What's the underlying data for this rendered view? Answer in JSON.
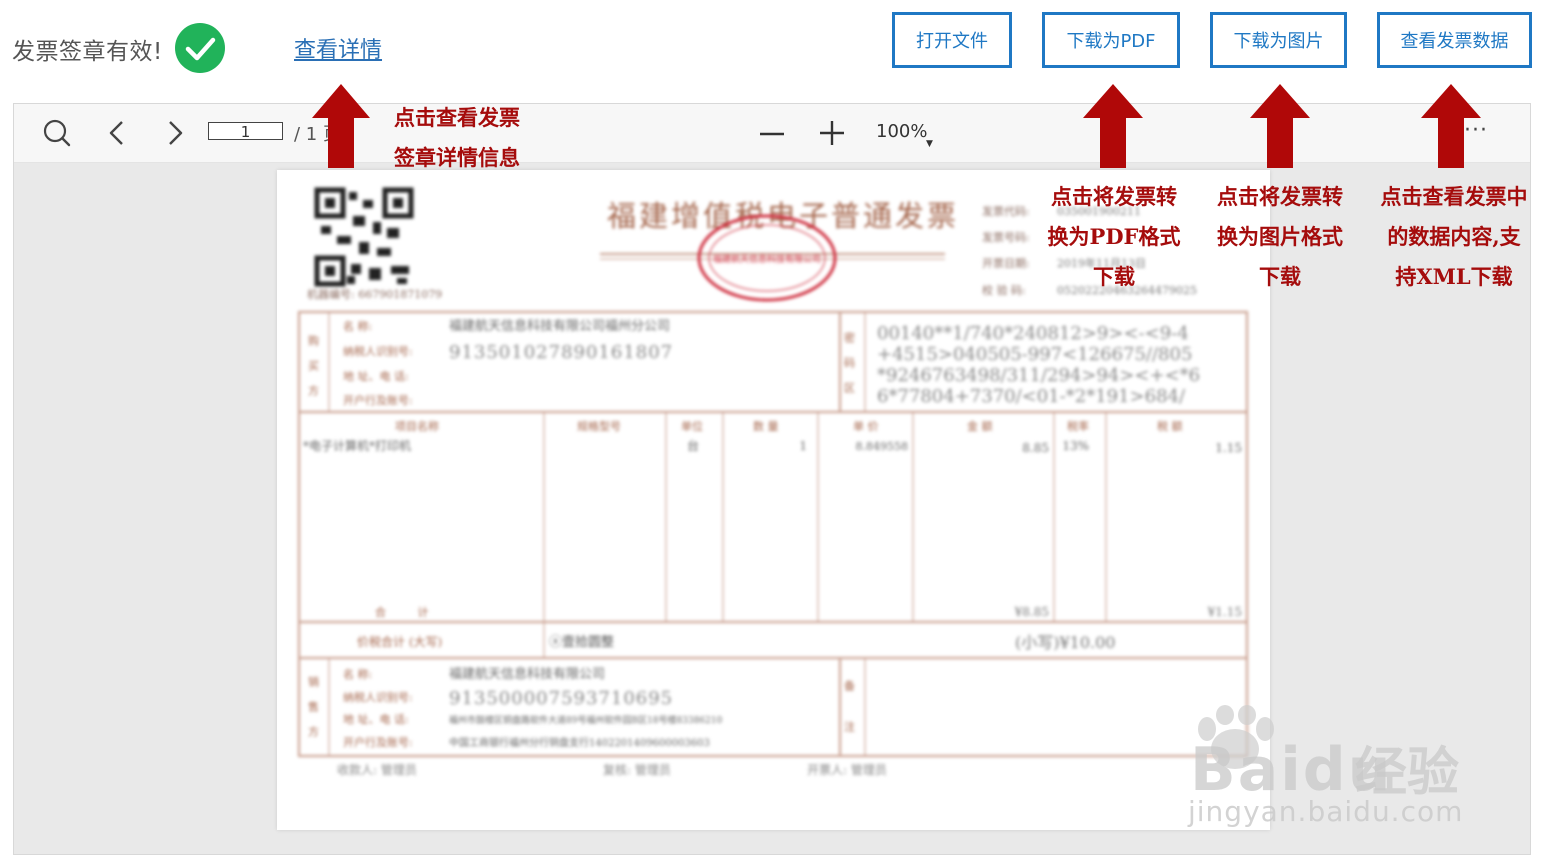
{
  "status": {
    "text": "发票签章有效!",
    "details_link": "查看详情"
  },
  "buttons": {
    "open": "打开文件",
    "pdf": "下载为PDF",
    "image": "下载为图片",
    "data": "查看发票数据"
  },
  "viewer": {
    "page_current": "1",
    "page_total": "/ 1 页",
    "zoom": "100%"
  },
  "invoice": {
    "title": "福建增值税电子普通发票",
    "machine_no": "机器编号: 667901871079",
    "invoice_code_label": "发票代码:",
    "invoice_code": "035001900211",
    "invoice_no_label": "发票号码:",
    "invoice_no": "",
    "issue_date_label": "开票日期:",
    "issue_date": "2019年11月13日",
    "check_code_label": "校 验 码:",
    "check_code": "05202220463264479025",
    "buyer_side_label": "购买方",
    "buyer_name_label": "名 称:",
    "buyer_name": "福建航天信息科技有限公司福州分公司",
    "buyer_taxid_label": "纳税人识别号:",
    "buyer_taxid": "91350102789016180​7",
    "buyer_addr_label": "地 址、电 话:",
    "buyer_bank_label": "开户行及账号:",
    "cipher_label": "密码区",
    "cipher_lines": [
      "00140**1/740*240812>9><-<9-4",
      "+4515>040505-997<126675//805",
      "*9246763498/311/294>94><+<*6",
      "6*77804+7370/<01-*2*191>684/"
    ],
    "col_item": "项目名称",
    "col_spec": "规格型号",
    "col_unit": "单位",
    "col_qty": "数 量",
    "col_price": "单 价",
    "col_amount": "金 额",
    "col_rate": "税率",
    "col_tax": "税 额",
    "item_name": "*电子计算机*打印机",
    "item_unit": "台",
    "item_qty": "1",
    "item_price": "8.849558",
    "item_amount": "8.85",
    "item_rate": "13%",
    "item_tax": "1.15",
    "total_label": "合 计",
    "total_amount": "¥8.85",
    "total_tax": "¥1.15",
    "sum_label": "价税合计 (大写)",
    "sum_upper": "ⓧ壹拾圆整",
    "sum_lower": "(小写)¥10.00",
    "seller_side_label": "销售方",
    "seller_name_label": "名 称:",
    "seller_name": "福建航天信息科技有限公司",
    "seller_taxid_label": "纳税人识别号:",
    "seller_taxid": "913500007593710695",
    "seller_addr_label": "地 址、电 话:",
    "seller_addr": "福州市鼓楼区铜盘路软件大道89号福州软件园B区18号楼83386210",
    "seller_bank_label": "开户行及账号:",
    "seller_bank": "中国工商银行福州分行铜盘支行1402201409600003603",
    "remark_label": "备注",
    "payee": "收款人: 管理员",
    "reviewer": "复核: 管理员",
    "drawer": "开票人: 管理员",
    "seal_text": "福建航天信息科技有限公司"
  },
  "notes": {
    "details_l1": "点击查看发票",
    "details_l2": "签章详情信息",
    "pdf_l1": "点击将发票转",
    "pdf_l2": "换为PDF格式",
    "pdf_l3": "下载",
    "image_l1": "点击将发票转",
    "image_l2": "换为图片格式",
    "image_l3": "下载",
    "data_l1": "点击查看发票中",
    "data_l2": "的数据内容,支",
    "data_l3": "持XML下载"
  },
  "watermark": {
    "brand": "Bai",
    "brand2": "du",
    "cn": "经验",
    "url": "jingyan.baidu.com"
  },
  "colors": {
    "accent": "#1f78c4",
    "annotation": "#a50c0c",
    "success": "#21b35a",
    "invoice_line": "#c79b8a"
  }
}
